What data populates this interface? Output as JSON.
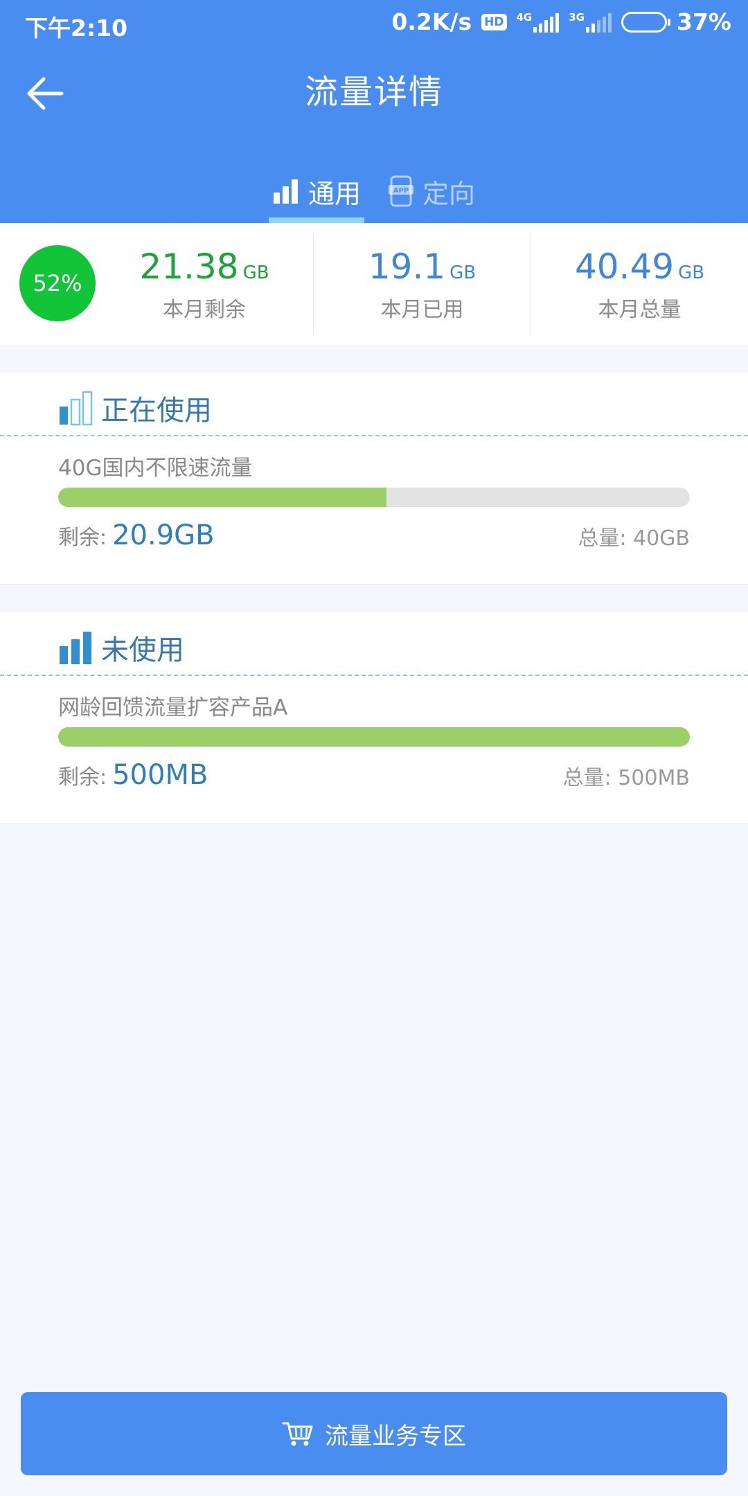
{
  "status_bar": {
    "time": "下午2:10",
    "speed": "0.2K/s",
    "hd": "HD",
    "net1": "4G",
    "net2": "3G",
    "battery": "37%",
    "battery_level": 0.37
  },
  "nav": {
    "title": "流量详情"
  },
  "tabs": [
    {
      "label": "通用",
      "icon": "bar-chart-icon",
      "active": true
    },
    {
      "label": "定向",
      "icon": "app-phone-icon",
      "active": false
    }
  ],
  "summary": {
    "percent": "52%",
    "remaining": {
      "value": "21.38",
      "unit": "GB",
      "label": "本月剩余"
    },
    "used": {
      "value": "19.1",
      "unit": "GB",
      "label": "本月已用"
    },
    "total": {
      "value": "40.49",
      "unit": "GB",
      "label": "本月总量"
    }
  },
  "packages": [
    {
      "section": "正在使用",
      "name": "40G国内不限速流量",
      "remain_label": "剩余:",
      "remain_value": "20.9GB",
      "total_text": "总量: 40GB",
      "fill_fraction": 0.52
    },
    {
      "section": "未使用",
      "name": "网龄回馈流量扩容产品A",
      "remain_label": "剩余:",
      "remain_value": "500MB",
      "total_text": "总量: 500MB",
      "fill_fraction": 1.0
    }
  ],
  "cta": {
    "label": "流量业务专区",
    "icon": "cart-icon"
  },
  "colors": {
    "primary": "#4a8df0",
    "green_circle": "#12c437",
    "remaining_text": "#1ea23a",
    "used_text": "#3f86d9",
    "bar_fill": "#9bcf67"
  }
}
